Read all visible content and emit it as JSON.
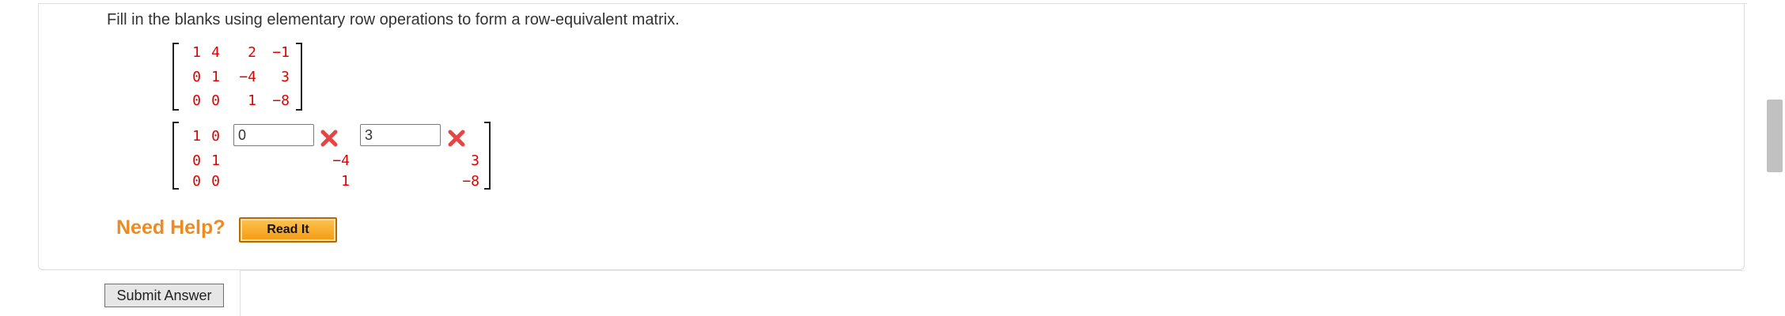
{
  "question": {
    "prompt": "Fill in the blanks using elementary row operations to form a row-equivalent matrix."
  },
  "given_matrix": {
    "rows": [
      [
        "1",
        "4",
        "2",
        "−1"
      ],
      [
        "0",
        "1",
        "−4",
        "3"
      ],
      [
        "0",
        "0",
        "1",
        "−8"
      ]
    ]
  },
  "answer_matrix": {
    "row1": {
      "c1": "1",
      "c2": "0",
      "input3_value": "0",
      "input4_value": "3"
    },
    "row2": {
      "c1": "0",
      "c2": "1",
      "c3": "−4",
      "c4": "3"
    },
    "row3": {
      "c1": "0",
      "c2": "0",
      "c3": "1",
      "c4": "−8"
    }
  },
  "feedback": {
    "input3_status": "incorrect",
    "input4_status": "incorrect",
    "incorrect_color": "#e64545"
  },
  "help": {
    "label": "Need Help?",
    "read_it_label": "Read It"
  },
  "actions": {
    "submit_label": "Submit Answer"
  },
  "colors": {
    "matrix_text": "#e00000",
    "help_accent": "#ef8a1f"
  }
}
